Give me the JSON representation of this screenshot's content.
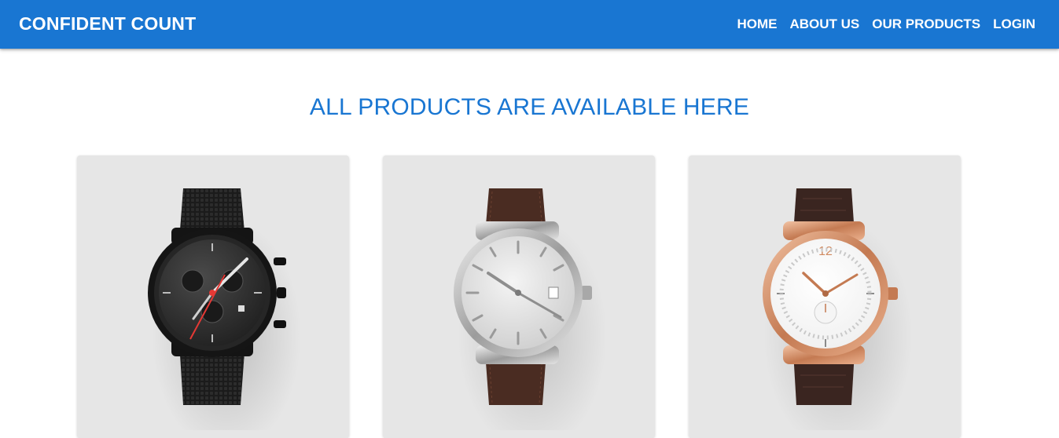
{
  "navbar": {
    "brand": "CONFIDENT COUNT",
    "links": [
      "HOME",
      "ABOUT US",
      "OUR PRODUCTS",
      "LOGIN"
    ]
  },
  "main": {
    "heading": "ALL PRODUCTS ARE AVAILABLE HERE",
    "products": [
      {
        "image": "black-chronograph-watch-mesh-strap"
      },
      {
        "image": "silver-dial-watch-brown-leather-strap"
      },
      {
        "image": "rose-gold-watch-dark-leather-strap"
      }
    ]
  },
  "colors": {
    "primary": "#1976d2",
    "card_background": "#e6e6e6"
  }
}
